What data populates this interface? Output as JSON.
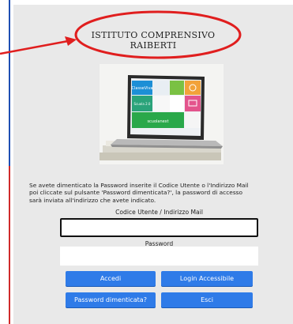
{
  "header": {
    "school_line1": "ISTITUTO COMPRENSIVO",
    "school_line2": "RAIBERTI"
  },
  "hero": {
    "tile_classeviva": "ClasseViva",
    "tile_spaggiari": "Scuola 2.0",
    "tile_scuolanext": "scuolanext"
  },
  "info": {
    "line1": "Se avete dimenticato la Password inserite il Codice Utente o l'Indirizzo Mail",
    "line2": "poi cliccate sul pulsante 'Password dimenticata?', la password di accesso",
    "line3": "sarà inviata all'indirizzo che avete indicato."
  },
  "form": {
    "user_label": "Codice Utente / Indirizzo Mail",
    "user_value": "",
    "password_label": "Password",
    "password_value": ""
  },
  "buttons": {
    "login": "Accedi",
    "login_accessible": "Login Accessibile",
    "forgot_password": "Password dimenticata?",
    "exit": "Esci"
  },
  "colors": {
    "button": "#2f7be8",
    "annotation": "#e01e1e",
    "panel": "#e9e9e9"
  }
}
